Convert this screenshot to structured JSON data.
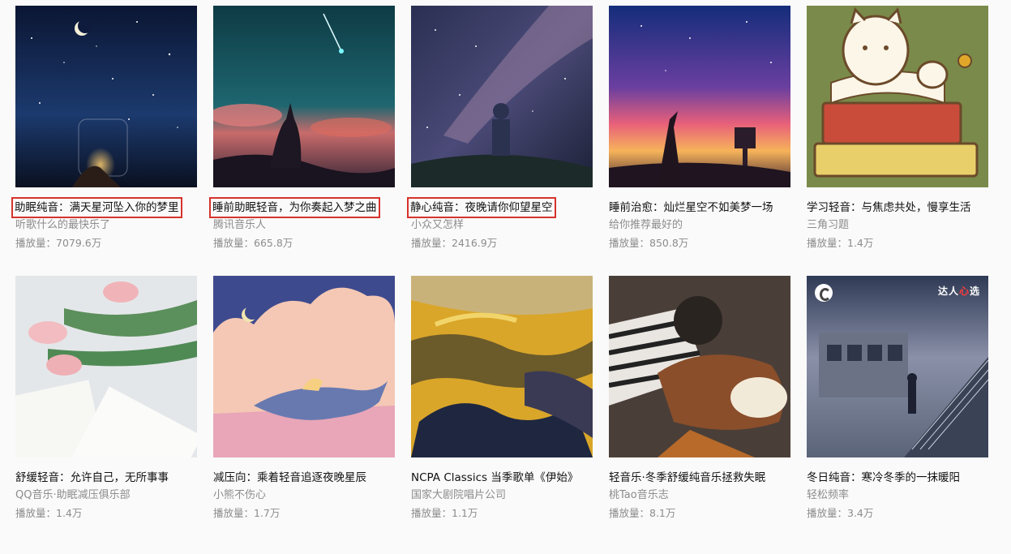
{
  "playlists": [
    {
      "title": "助眠纯音：满天星河坠入你的梦里",
      "creator": "听歌什么的最快乐了",
      "plays": "播放量：7079.6万",
      "highlighted": true,
      "cover_icon": "starry-jar-image"
    },
    {
      "title": "睡前助眠轻音，为你奏起入梦之曲",
      "creator": "腾讯音乐人",
      "plays": "播放量：665.8万",
      "highlighted": true,
      "cover_icon": "comet-sky-image"
    },
    {
      "title": "静心纯音：夜晚请你仰望星空",
      "creator": "小众又怎样",
      "plays": "播放量：2416.9万",
      "highlighted": true,
      "cover_icon": "milky-way-image"
    },
    {
      "title": "睡前治愈：灿烂星空不如美梦一场",
      "creator": "给你推荐最好的",
      "plays": "播放量：850.8万",
      "highlighted": false,
      "cover_icon": "sunset-tower-image"
    },
    {
      "title": "学习轻音：与焦虑共处，慢享生活",
      "creator": "三角习题",
      "plays": "播放量：1.4万",
      "highlighted": false,
      "cover_icon": "cat-books-image"
    },
    {
      "title": "舒缓轻音：允许自己，无所事事",
      "creator": "QQ音乐·助眠减压俱乐部",
      "plays": "播放量：1.4万",
      "highlighted": false,
      "cover_icon": "tulips-book-image"
    },
    {
      "title": "减压向：乘着轻音追逐夜晚星辰",
      "creator": "小熊不伤心",
      "plays": "播放量：1.7万",
      "highlighted": false,
      "cover_icon": "whale-clouds-image"
    },
    {
      "title": "NCPA Classics 当季歌单《伊始》",
      "creator": "国家大剧院唱片公司",
      "plays": "播放量：1.1万",
      "highlighted": false,
      "cover_icon": "abstract-landscape-image"
    },
    {
      "title": "轻音乐·冬季舒缓纯音乐拯救失眠",
      "creator": "桃Tao音乐志",
      "plays": "播放量：8.1万",
      "highlighted": false,
      "cover_icon": "girl-dog-image"
    },
    {
      "title": "冬日纯音：寒冷冬季的一抹暖阳",
      "creator": "轻松频率",
      "plays": "播放量：3.4万",
      "highlighted": false,
      "cover_icon": "stairs-station-image",
      "badge_pre": "达人",
      "badge_hl": "心",
      "badge_post": "选"
    }
  ],
  "colors": {
    "highlight_box": "#d6332c",
    "text_primary": "#111111",
    "text_secondary": "#8c8c8c"
  }
}
